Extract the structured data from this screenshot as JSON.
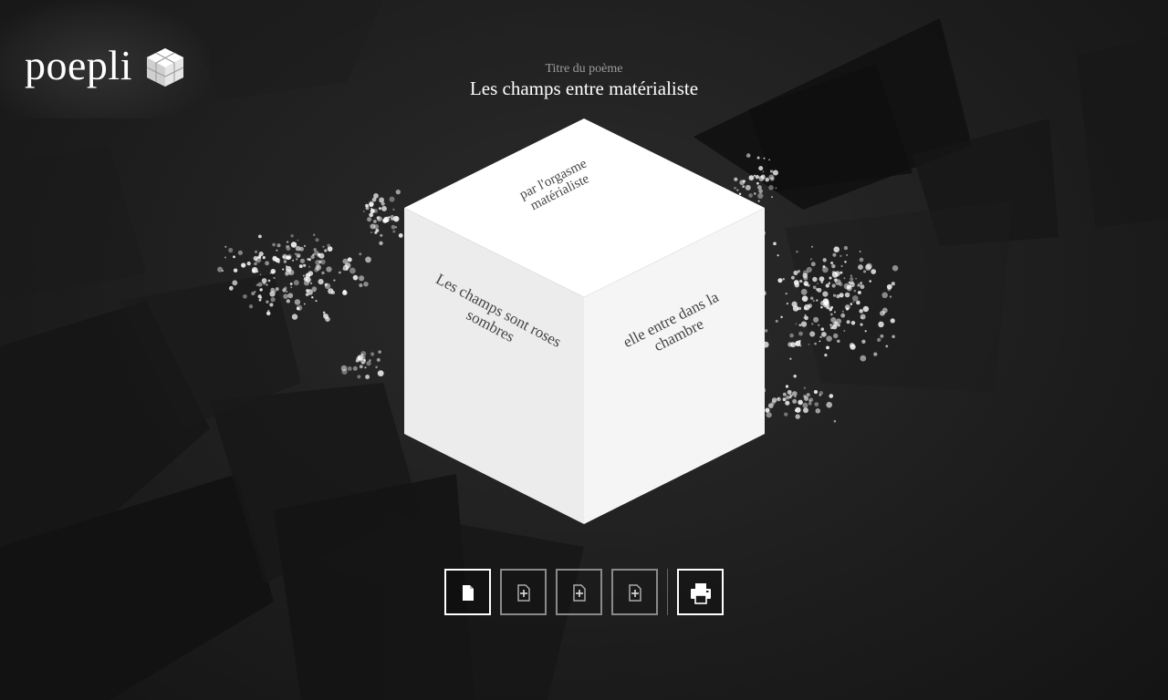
{
  "app": {
    "logo_text": "poepli"
  },
  "poem": {
    "title_caption": "Titre du poème",
    "title": "Les champs entre matérialiste",
    "faces": {
      "top": "par l'orgasme matérialiste",
      "left": "Les champs sont roses sombres",
      "right": "elle entre dans la chambre"
    }
  },
  "toolbar": {
    "buttons": [
      {
        "name": "page-button",
        "icon": "page-icon",
        "active": true
      },
      {
        "name": "add-page-button-1",
        "icon": "page-plus-icon",
        "active": false
      },
      {
        "name": "add-page-button-2",
        "icon": "page-plus-icon",
        "active": false
      },
      {
        "name": "add-page-button-3",
        "icon": "page-plus-icon",
        "active": false
      },
      {
        "name": "print-button",
        "icon": "printer-icon",
        "active": true
      }
    ]
  },
  "colors": {
    "background": "#1f1f1f",
    "cube_top": "#ffffff",
    "cube_left": "#ececec",
    "cube_right": "#f5f5f5",
    "face_text": "#444444",
    "accent": "#ffffff"
  }
}
